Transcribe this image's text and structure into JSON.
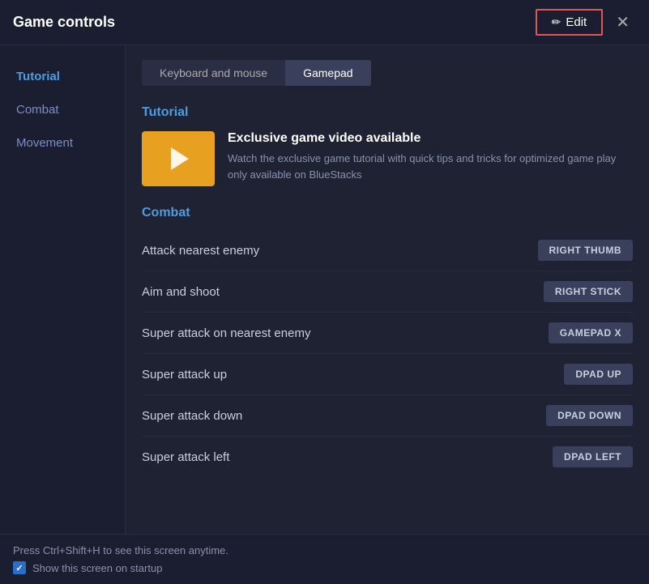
{
  "window": {
    "title": "Game controls"
  },
  "header": {
    "edit_label": "Edit",
    "close_label": "✕"
  },
  "sidebar": {
    "items": [
      {
        "id": "tutorial",
        "label": "Tutorial",
        "active": true
      },
      {
        "id": "combat",
        "label": "Combat",
        "active": false
      },
      {
        "id": "movement",
        "label": "Movement",
        "active": false
      }
    ]
  },
  "tabs": [
    {
      "id": "keyboard",
      "label": "Keyboard and mouse",
      "active": false
    },
    {
      "id": "gamepad",
      "label": "Gamepad",
      "active": true
    }
  ],
  "tutorial_section": {
    "title": "Tutorial",
    "video_title": "Exclusive game video available",
    "video_description": "Watch the exclusive game tutorial with quick tips and tricks for optimized game play only available on BlueStacks"
  },
  "combat_section": {
    "title": "Combat",
    "controls": [
      {
        "label": "Attack nearest enemy",
        "badge": "RIGHT THUMB"
      },
      {
        "label": "Aim and shoot",
        "badge": "RIGHT STICK"
      },
      {
        "label": "Super attack on nearest enemy",
        "badge": "GAMEPAD X"
      },
      {
        "label": "Super attack up",
        "badge": "DPAD UP"
      },
      {
        "label": "Super attack down",
        "badge": "DPAD DOWN"
      },
      {
        "label": "Super attack left",
        "badge": "DPAD LEFT"
      }
    ]
  },
  "bottom": {
    "hint": "Press Ctrl+Shift+H to see this screen anytime.",
    "checkbox_label": "Show this screen on startup",
    "checked": true
  }
}
